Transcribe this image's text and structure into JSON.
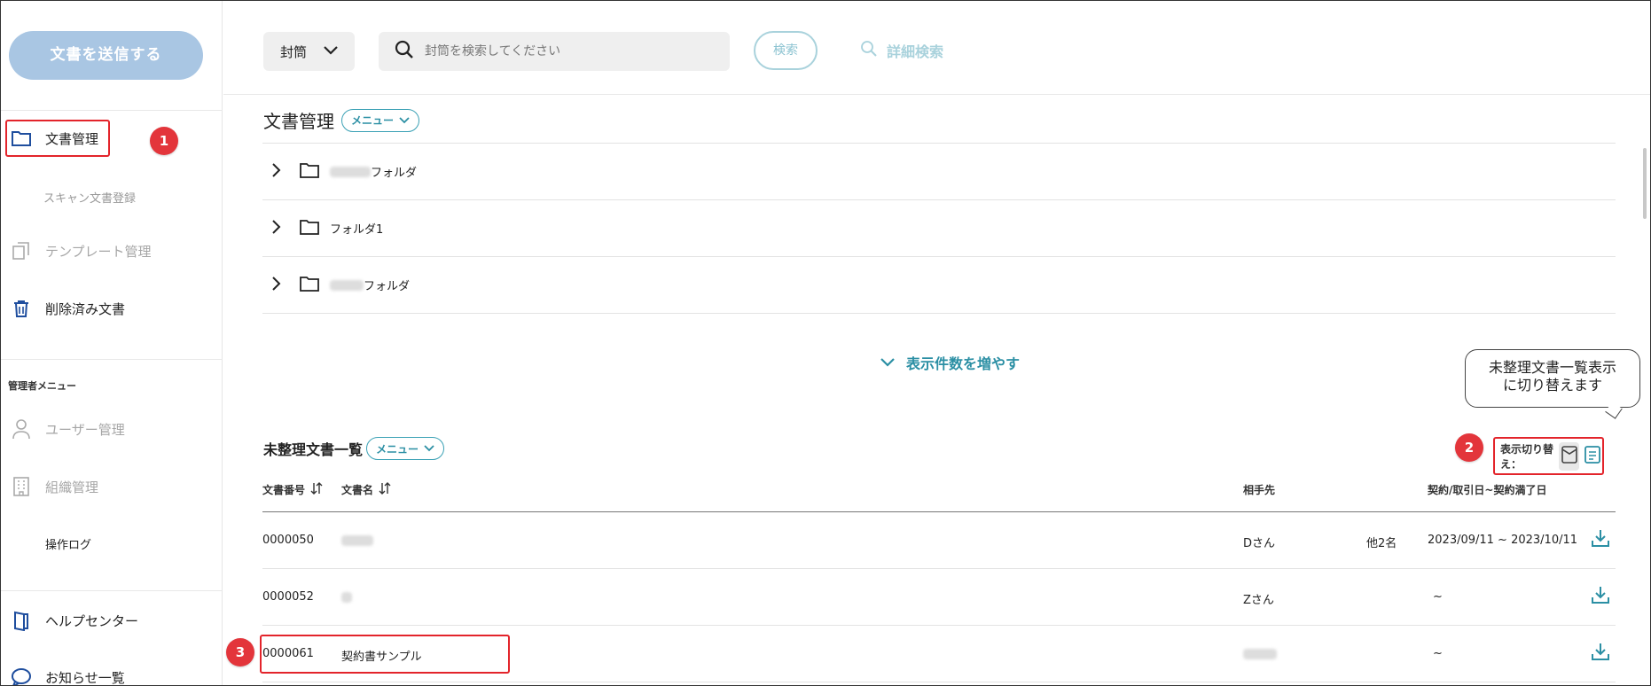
{
  "sidebar": {
    "send_button": "文書を送信する",
    "items": [
      {
        "label": "文書管理",
        "icon": "folder-icon"
      },
      {
        "label": "スキャン文書登録"
      },
      {
        "label": "テンプレート管理",
        "icon": "template-icon"
      },
      {
        "label": "削除済み文書",
        "icon": "trash-icon"
      }
    ],
    "admin_heading": "管理者メニュー",
    "admin_items": [
      {
        "label": "ユーザー管理",
        "icon": "user-icon"
      },
      {
        "label": "組織管理",
        "icon": "building-icon"
      },
      {
        "label": "操作ログ"
      }
    ],
    "bottom_items": [
      {
        "label": "ヘルプセンター",
        "icon": "book-icon"
      },
      {
        "label": "お知らせ一覧",
        "icon": "chat-icon"
      }
    ]
  },
  "topbar": {
    "envelope_dropdown": "封筒",
    "search_placeholder": "封筒を検索してください",
    "search_button": "検索",
    "advanced_search": "詳細検索"
  },
  "documents": {
    "title": "文書管理",
    "menu_label": "メニュー",
    "folders": [
      {
        "name": "フォルダ"
      },
      {
        "name": "フォルダ1"
      },
      {
        "name": "フォルダ"
      }
    ],
    "show_more": "表示件数を増やす"
  },
  "unsorted": {
    "title": "未整理文書一覧",
    "menu_label": "メニュー",
    "toggle_label": "表示切り替え：",
    "tooltip_line1": "未整理文書一覧表示",
    "tooltip_line2": "に切り替えます",
    "columns": {
      "doc_number": "文書番号",
      "doc_name": "文書名",
      "counterpart": "相手先",
      "dates": "契約/取引日~契約満了日"
    },
    "rows": [
      {
        "number": "0000050",
        "name": "",
        "counterpart": "Dさん",
        "others": "他2名",
        "dates": "2023/09/11  ~  2023/10/11"
      },
      {
        "number": "0000052",
        "name": "",
        "counterpart": "Zさん",
        "others": "",
        "dates": "~"
      },
      {
        "number": "0000061",
        "name": "契約書サンプル",
        "counterpart": "",
        "others": "",
        "dates": "~"
      }
    ]
  },
  "callouts": {
    "one": "1",
    "two": "2",
    "three": "3"
  },
  "colors": {
    "accent": "#2b8fa4",
    "callout": "#e3353b",
    "send_button": "#a9c6e3"
  }
}
